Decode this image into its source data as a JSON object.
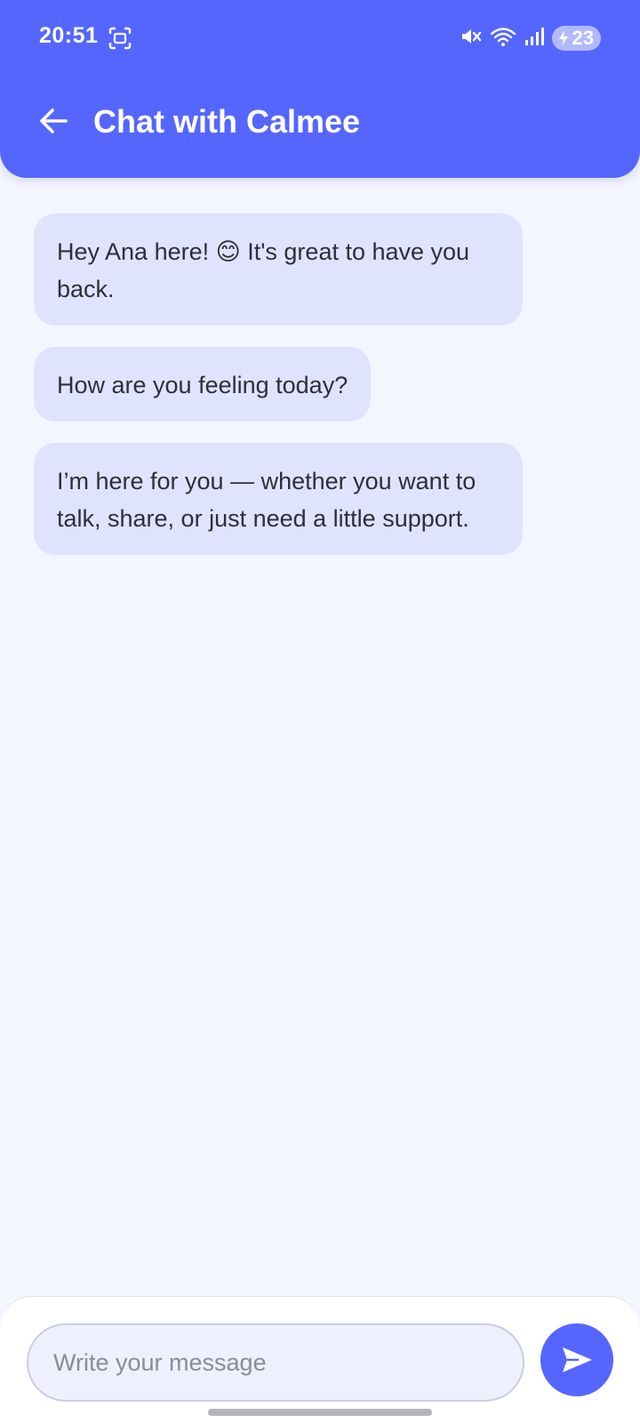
{
  "status_bar": {
    "time": "20:51",
    "battery_level": "23",
    "icons": [
      "screenshot-icon",
      "mute-icon",
      "wifi-icon",
      "signal-icon",
      "battery-charging-icon"
    ]
  },
  "header": {
    "title": "Chat with Calmee",
    "back_icon": "arrow-left-icon"
  },
  "messages": [
    {
      "text": "Hey Ana here! 😊 It's great to have you back."
    },
    {
      "text": "How are you feeling today?"
    },
    {
      "text": "I’m here for you — whether you want to talk, share, or just need a little support."
    }
  ],
  "composer": {
    "placeholder": "Write your message",
    "value": "",
    "send_icon": "send-icon"
  },
  "colors": {
    "accent": "#5566ff",
    "bubble": "#dfe3fe",
    "background": "#f4f6ff"
  }
}
